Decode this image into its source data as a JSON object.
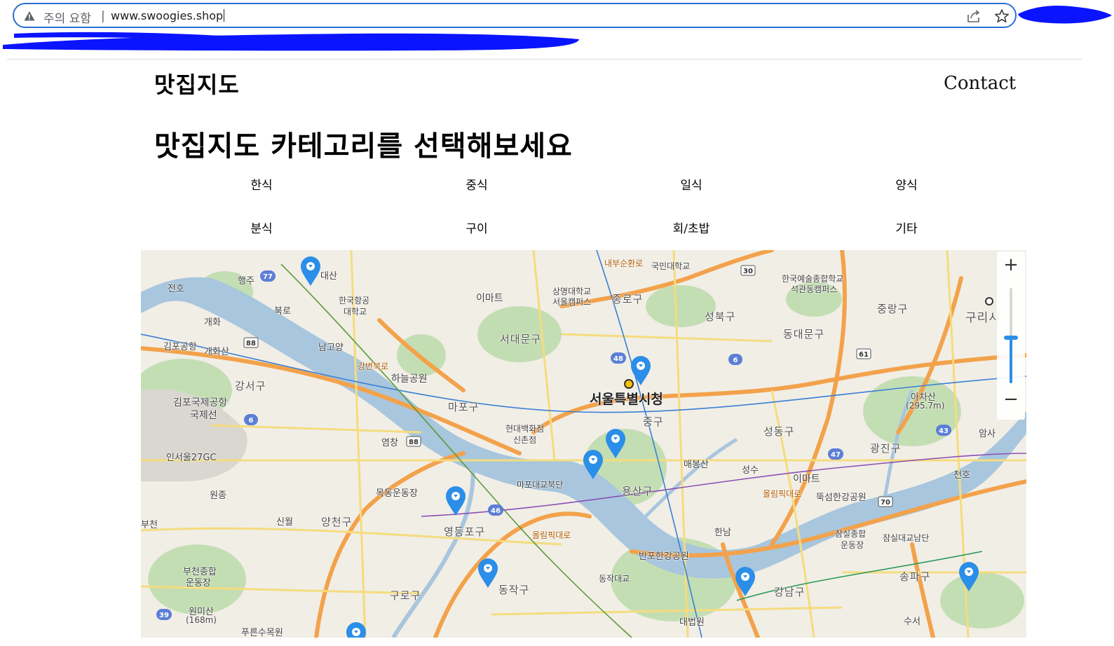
{
  "browser": {
    "security_label": "주의 요함",
    "separator": "|",
    "url": "www.swoogies.shop"
  },
  "site": {
    "brand": "맛집지도",
    "nav_contact": "Contact",
    "headline": "맛집지도 카테고리를 선택해보세요"
  },
  "categories": [
    {
      "label": "한식"
    },
    {
      "label": "중식"
    },
    {
      "label": "일식"
    },
    {
      "label": "양식"
    },
    {
      "label": "분식"
    },
    {
      "label": "구이"
    },
    {
      "label": "회/초밥"
    },
    {
      "label": "기타"
    }
  ],
  "map": {
    "labels": {
      "city_hall": "서울특별시청",
      "mapo": "마포구",
      "seodaemun": "서대문구",
      "jongno": "종로구",
      "seongbuk": "성북구",
      "dongdaemun": "동대문구",
      "jungnang": "중랑구",
      "junggu": "중구",
      "yongsan": "용산구",
      "seongdong": "성동구",
      "gwangjin": "광진구",
      "gangseo": "강서구",
      "yangcheon": "양천구",
      "yeongdeungpo": "영등포구",
      "guro": "구로구",
      "dongjak": "동작구",
      "gangnam": "강남구",
      "songpa": "송파구",
      "guri": "구리시",
      "gimpo_airport": "김포국제공항",
      "gimpo_airport_domestic": "국제선",
      "hanul_park": "하늘공원",
      "hyundai_dept": "현대백화점",
      "hyundai_dept_branch": "신촌점",
      "emart": "이마트",
      "emart2": "이마트",
      "mapo_bridge": "마포대교북단",
      "banpo_park": "반포한강공원",
      "ttukseom_park": "뚝섬한강공원",
      "jamsil_sports": "잠실종합",
      "jamsil_sports2": "운동장",
      "jamsil_bridge": "잠실대교남단",
      "mokdong": "목동운동장",
      "achasan": "아차산",
      "achasan_height": "(295.7m)",
      "hanam_uni": "한국항공",
      "hanam_uni2": "대학교",
      "sangmyung": "상명대학교",
      "sangmyung2": "서울캠퍼스",
      "kookmin": "국민대학교",
      "karts": "한국예술종합학교",
      "karts2": "석관동캠퍼스",
      "eungbong": "매봉산",
      "seongsu": "성수",
      "dongjak_bridge": "동작대교",
      "supreme_court": "대법원",
      "bucheon_sports": "부천종합",
      "bucheon_sports2": "운동장",
      "wonmisan": "원미산",
      "wonmisan_height": "(168m)",
      "incheon_gc": "인서울27GC",
      "gaehwa": "개화",
      "gaehwasan": "개화산",
      "gimpo_airport_st": "김포공항",
      "haengju": "행주",
      "bukro": "북로",
      "namgoyang": "남고양",
      "yeomchang": "염창",
      "sinwol": "신월",
      "wonjong": "원종",
      "bucheon": "부천",
      "jeonho": "전호",
      "daesan": "대산",
      "hannam": "한남",
      "sinsa": "수서",
      "cheonho": "천호",
      "amsa": "암사",
      "olympic_road": "올림픽대로",
      "olympic_road2": "올림픽대로",
      "gangbyeon_road": "강변북로",
      "naebu_road": "내부순환로",
      "pureun_mokwon": "푸른수목원"
    },
    "road_badges": [
      "77",
      "88",
      "6",
      "48",
      "6",
      "30",
      "61",
      "43",
      "47",
      "70",
      "46",
      "88",
      "39"
    ],
    "zoom_in": "+",
    "zoom_out": "−",
    "zoom_level": 0.45,
    "marker_count": 9
  },
  "colors": {
    "accent": "#2b6fd8",
    "marker": "#2b8ee8",
    "water": "#a3c4dc",
    "park": "#b9d7a8",
    "road_major": "#f3a24b",
    "road_minor": "#f7e07a"
  },
  "icons": {
    "warning": "warning-triangle-icon",
    "share": "share-icon",
    "star": "bookmark-star-icon",
    "marker": "map-pin-icon"
  }
}
